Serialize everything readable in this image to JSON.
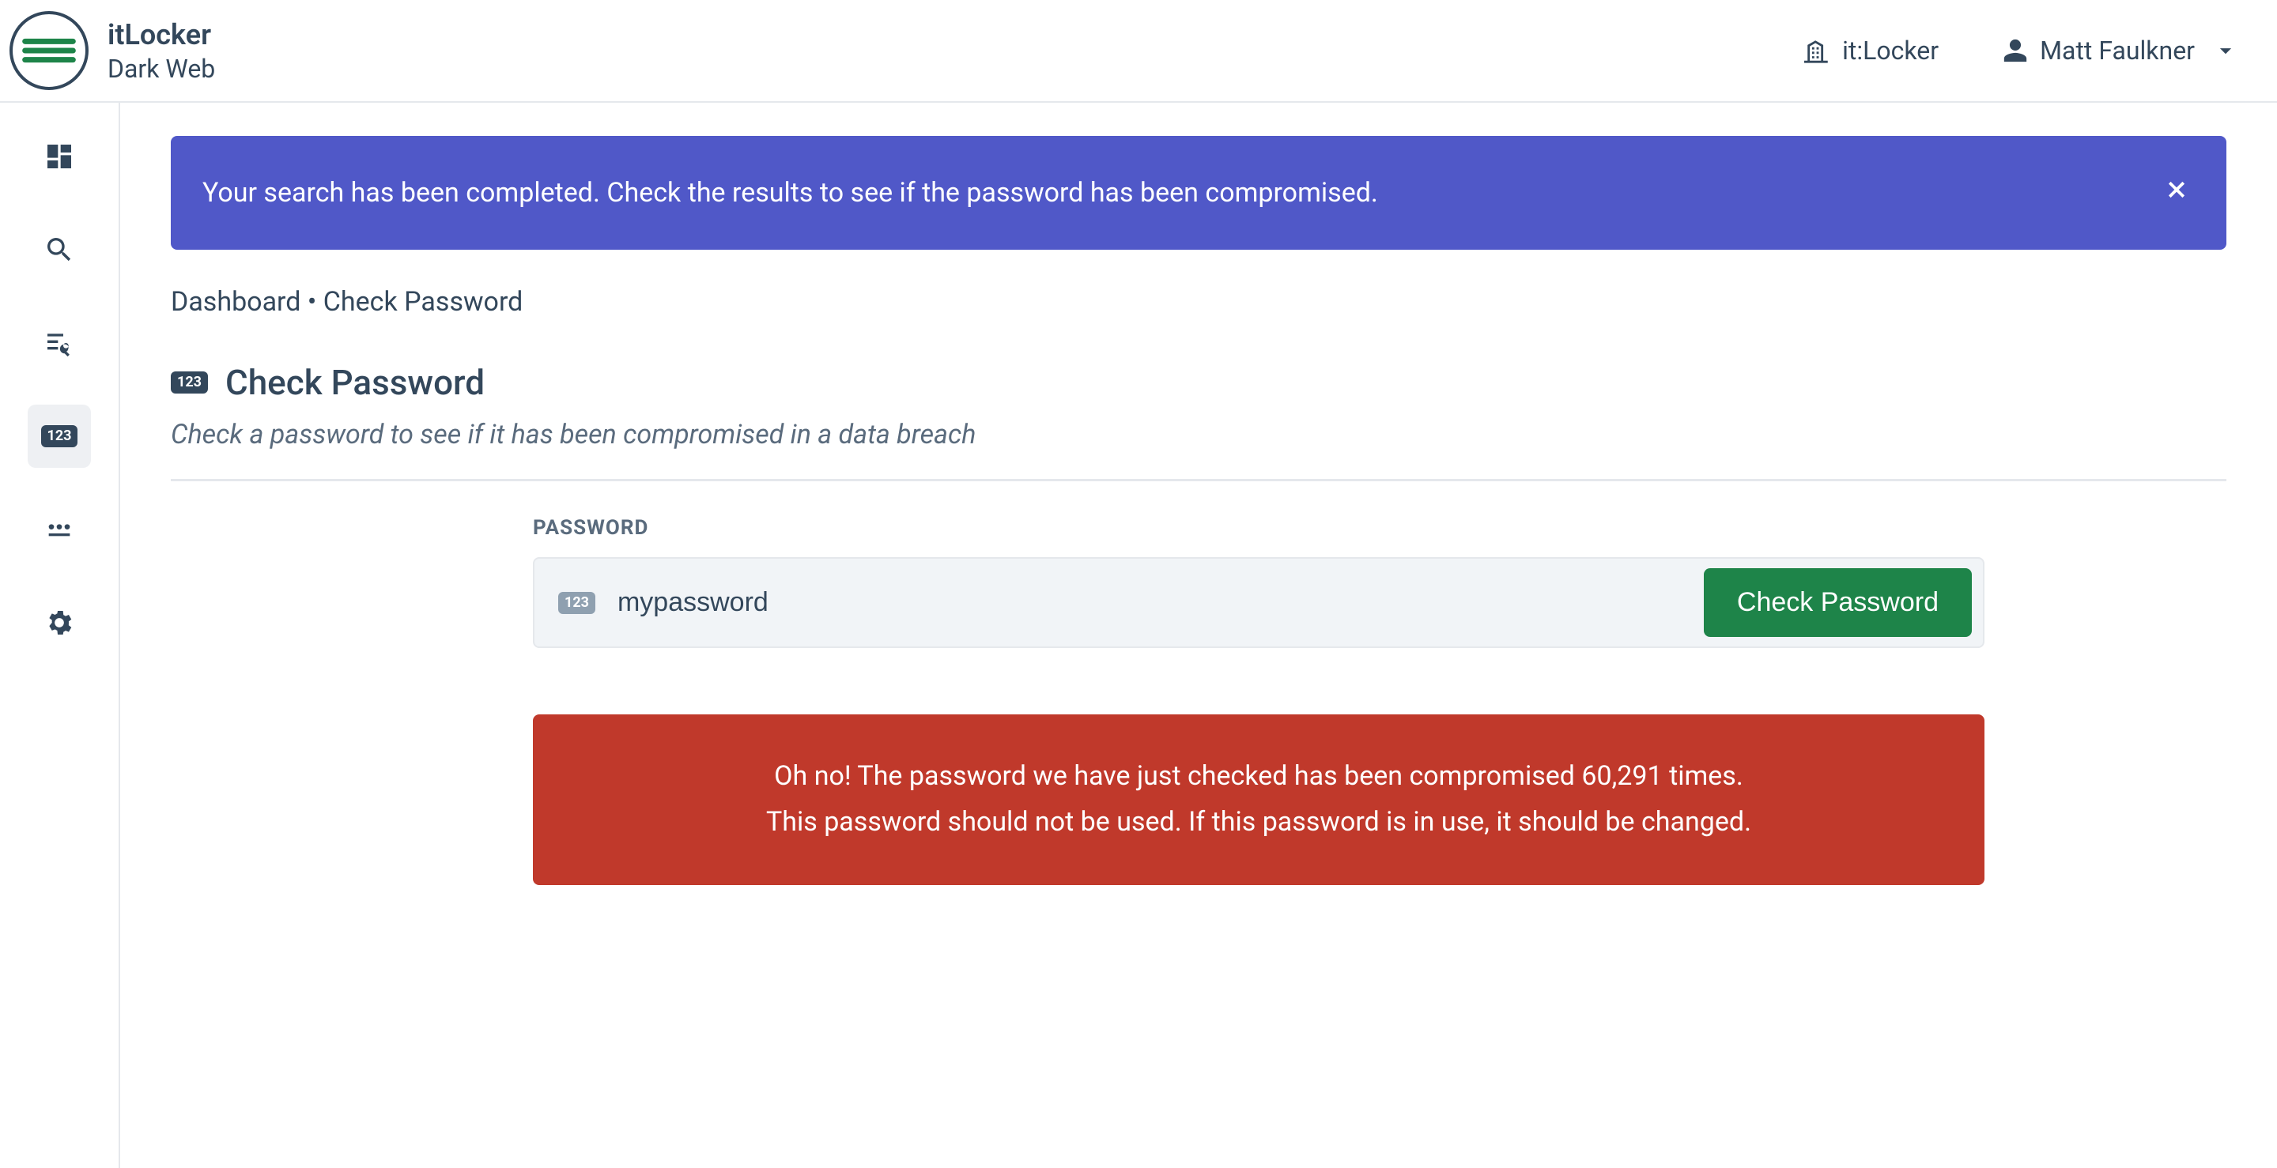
{
  "header": {
    "brand_title": "itLocker",
    "brand_sub": "Dark Web",
    "org_label": "it:Locker",
    "user_name": "Matt Faulkner"
  },
  "banner": {
    "message": "Your search has been completed. Check the results to see if the password has been compromised."
  },
  "breadcrumb": {
    "root": "Dashboard",
    "separator": " • ",
    "current": "Check Password"
  },
  "page": {
    "title": "Check Password",
    "subtitle": "Check a password to see if it has been compromised in a data breach"
  },
  "form": {
    "field_label": "PASSWORD",
    "password_value": "mypassword",
    "submit_label": "Check Password",
    "badge_text": "123"
  },
  "result": {
    "line1": "Oh no! The password we have just checked has been compromised 60,291 times.",
    "line2": "This password should not be used. If this password is in use, it should be changed."
  },
  "sidebar": {
    "items": [
      {
        "name": "dashboard"
      },
      {
        "name": "search"
      },
      {
        "name": "list-search"
      },
      {
        "name": "check-password",
        "active": true
      },
      {
        "name": "hidden"
      },
      {
        "name": "settings"
      }
    ],
    "badge_text": "123"
  },
  "colors": {
    "banner_bg": "#5058c8",
    "danger_bg": "#c0392b",
    "primary_btn_bg": "#1e8449",
    "text": "#33475b"
  }
}
